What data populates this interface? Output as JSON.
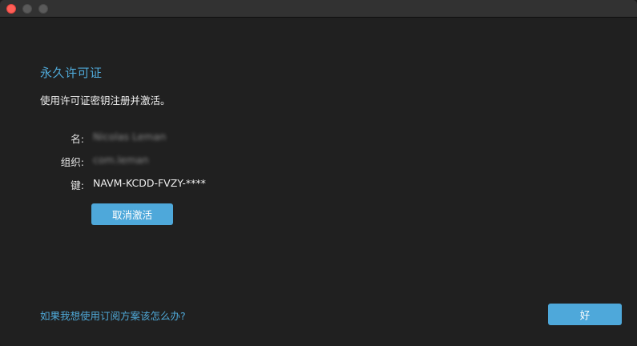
{
  "window": {
    "traffic_lights": [
      "close",
      "minimize",
      "zoom"
    ],
    "colors": {
      "close": "#ff5f57",
      "inactive": "#5a5a5a",
      "accent": "#4ea8da",
      "background": "#202020"
    }
  },
  "license": {
    "heading": "永久许可证",
    "subtitle": "使用许可证密钥注册并激活。",
    "fields": [
      {
        "label": "名:",
        "value": "Nicolas Leman"
      },
      {
        "label": "组织:",
        "value": "com.leman"
      },
      {
        "label": "键:",
        "value": "NAVM-KCDD-FVZY-****"
      }
    ],
    "deactivate_label": "取消激活"
  },
  "footer": {
    "subscription_link": "如果我想使用订阅方案该怎么办?",
    "ok_label": "好"
  }
}
